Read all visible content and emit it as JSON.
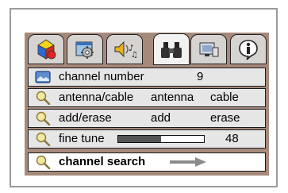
{
  "tabs": [
    {
      "name": "setup",
      "icon": "colored-shapes-icon",
      "active": false
    },
    {
      "name": "settings",
      "icon": "gear-window-icon",
      "active": false
    },
    {
      "name": "audio",
      "icon": "speaker-music-icon",
      "active": false
    },
    {
      "name": "channel",
      "icon": "binoculars-icon",
      "active": true
    },
    {
      "name": "input",
      "icon": "monitor-input-icon",
      "active": false
    },
    {
      "name": "info",
      "icon": "info-icon",
      "active": false
    }
  ],
  "menu": {
    "channel_number": {
      "label": "channel number",
      "value": "9",
      "icon": "tv-screen-icon"
    },
    "antenna_cable": {
      "label": "antenna/cable",
      "option1": "antenna",
      "option2": "cable",
      "icon": "magnifier-icon"
    },
    "add_erase": {
      "label": "add/erase",
      "option1": "add",
      "option2": "erase",
      "icon": "magnifier-icon"
    },
    "fine_tune": {
      "label": "fine tune",
      "value": "48",
      "level": 0.5,
      "icon": "magnifier-icon"
    },
    "channel_search": {
      "label": "channel search",
      "icon": "magnifier-icon",
      "action_icon": "arrow-right-icon"
    }
  },
  "colors": {
    "panel": "#a58a7b",
    "row": "#e6e6e6",
    "selected_row": "#ffffff",
    "tab": "#d6d3d0"
  }
}
